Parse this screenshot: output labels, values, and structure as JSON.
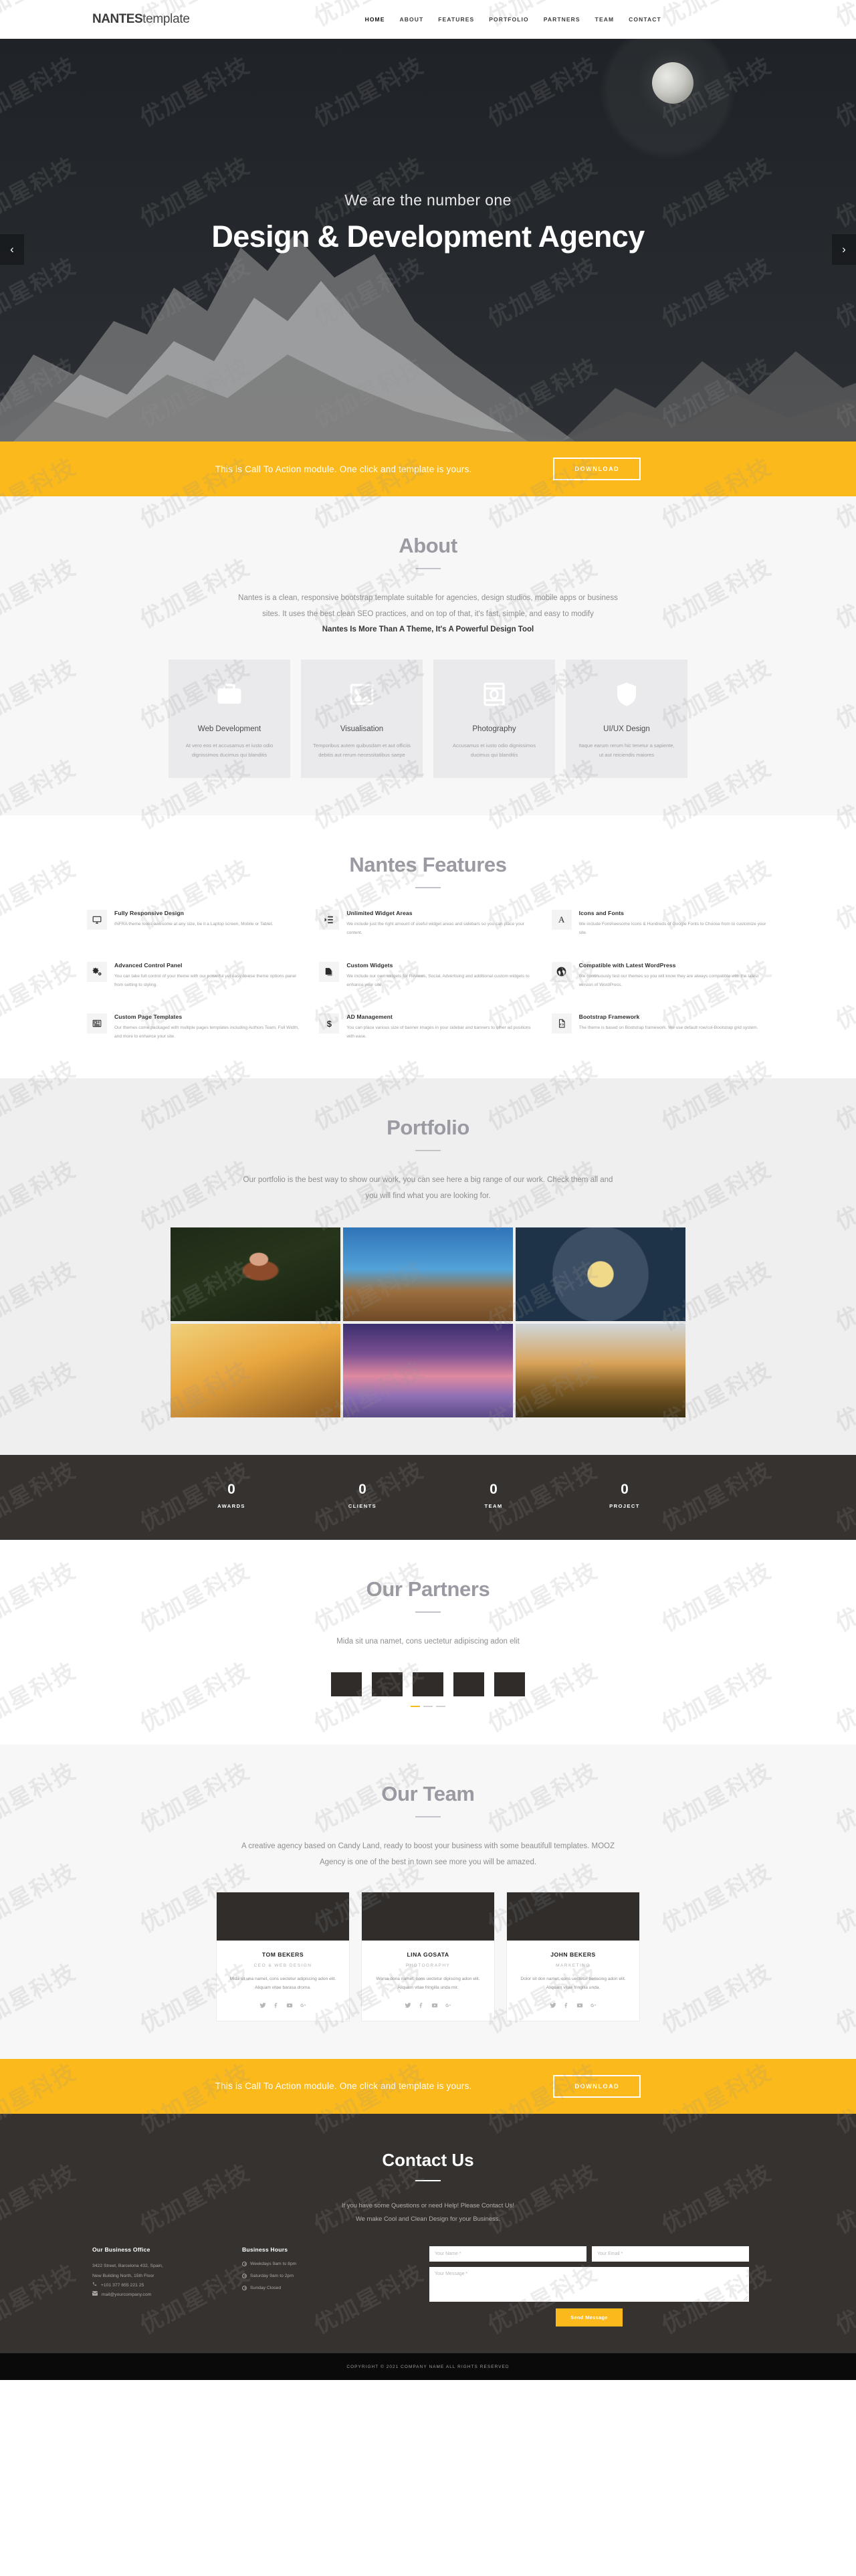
{
  "header": {
    "brand_bold": "NANTES",
    "brand_light": "template",
    "nav": [
      {
        "label": "HOME",
        "name": "nav-home"
      },
      {
        "label": "ABOUT",
        "name": "nav-about"
      },
      {
        "label": "FEATURES",
        "name": "nav-features"
      },
      {
        "label": "PORTFOLIO",
        "name": "nav-portfolio"
      },
      {
        "label": "PARTNERS",
        "name": "nav-partners"
      },
      {
        "label": "TEAM",
        "name": "nav-team"
      },
      {
        "label": "CONTACT",
        "name": "nav-contact"
      }
    ]
  },
  "hero": {
    "subtitle": "We are the number one",
    "title": "Design & Development Agency",
    "prev_icon": "‹",
    "next_icon": "›"
  },
  "cta": {
    "text": "This is Call To Action module. One click and template is yours.",
    "button": "DOWNLOAD",
    "accent": "#fbb91b"
  },
  "about": {
    "title": "About",
    "lead_line1": "Nantes is a clean, responsive bootstrap template suitable for agencies, design studios, mobile apps or business",
    "lead_line2": "sites. It uses the best clean SEO practices, and on top of that, it's fast, simple, and easy to modify",
    "lead_strong": "Nantes Is More Than A Theme, It's A Powerful Design Tool",
    "cards": [
      {
        "icon": "briefcase-icon",
        "title": "Web Development",
        "text": "At vero eos et accusamus et iusto odio dignissimos ducimus qui blanditis"
      },
      {
        "icon": "image-icon",
        "title": "Visualisation",
        "text": "Temporibus autem quibusdam et aut officiis debitis aut rerum necessitatibus saepe"
      },
      {
        "icon": "camera-icon",
        "title": "Photography",
        "text": "Accusamus et iusto odio dignissimos ducimus qui blanditis"
      },
      {
        "icon": "shield-icon",
        "title": "UI/UX Design",
        "text": "Itaque earum rerum hic tenetur a sapiente, ut aut reiciendis maiores"
      }
    ]
  },
  "features": {
    "title": "Nantes Features",
    "items": [
      {
        "icon": "monitor-icon",
        "glyph": "⎕",
        "title": "Fully Responsive Design",
        "text": "INFRA theme looks awesome at any size, be it a Laptop screen, Mobile or Tablet."
      },
      {
        "icon": "widget-list-icon",
        "glyph": "≡",
        "title": "Unlimited Widget Areas",
        "text": "We include just the right amount of useful widget areas and sidebars so you can place your content."
      },
      {
        "icon": "font-icon",
        "glyph": "A",
        "title": "Icons and Fonts",
        "text": "We include FontAwesome Icons & Hundreds of Google Fonts to Choose from to customize your site."
      },
      {
        "icon": "gears-icon",
        "glyph": "⚙",
        "title": "Advanced Control Panel",
        "text": "You can take full control of your theme with our powerful yet easy-to-use theme options panel from setting to styling."
      },
      {
        "icon": "copy-icon",
        "glyph": "❐",
        "title": "Custom Widgets",
        "text": "We include our own widgets for Reviews, Social, Advertising and additional custom widgets to enhance your site."
      },
      {
        "icon": "wordpress-icon",
        "glyph": "Ⓦ",
        "title": "Compatible with Latest WordPress",
        "text": "We continuously test our themes so you will know they are always compatible with the latest version of WordPress."
      },
      {
        "icon": "newspaper-icon",
        "glyph": "▤",
        "title": "Custom Page Templates",
        "text": "Our themes come packaged with multiple pages templates including Authors Team, Full Width, and more to enhance your site."
      },
      {
        "icon": "dollar-icon",
        "glyph": "$",
        "title": "AD Management",
        "text": "You can place various size of banner images in your sidebar and banners to other ad positions with ease."
      },
      {
        "icon": "code-file-icon",
        "glyph": "‹›",
        "title": "Bootstrap Framework",
        "text": "The theme is based on Bootstrap framework. We use default row/col-Bootstrap grid system."
      }
    ]
  },
  "portfolio": {
    "title": "Portfolio",
    "lead_line1": "Our portfolio is the best way to show our work, you can see here a big range of our work. Check them all and",
    "lead_line2": "you will find what you are looking for.",
    "items": [
      {
        "name": "portfolio-item-woman-forest"
      },
      {
        "name": "portfolio-item-architecture"
      },
      {
        "name": "portfolio-item-dome-ceiling"
      },
      {
        "name": "portfolio-item-golden-field"
      },
      {
        "name": "portfolio-item-boat-sunset"
      },
      {
        "name": "portfolio-item-cheers-bottles"
      }
    ]
  },
  "counters": [
    {
      "value": "0",
      "label": "AWARDS"
    },
    {
      "value": "0",
      "label": "CLIENTS"
    },
    {
      "value": "0",
      "label": "TEAM"
    },
    {
      "value": "0",
      "label": "PROJECT"
    }
  ],
  "partners": {
    "title": "Our Partners",
    "lead": "Mida sit una namet, cons uectetur adipiscing adon elit",
    "logo_count": 5,
    "dot_count": 3,
    "active_dot": 0
  },
  "team": {
    "title": "Our Team",
    "lead_line1": "A creative agency based on Candy Land, ready to boost your business with some beautifull templates. MOOZ",
    "lead_line2": "Agency is one of the best in town see more you will be amazed.",
    "members": [
      {
        "name": "TOM BEKERS",
        "role": "CEO & WEB DESIGN",
        "bio": "Mida sit una namet, cons uectetur adipiscing adon elit. Aliquam vitae barasa droma."
      },
      {
        "name": "LINA GOSATA",
        "role": "PHOTOGRAPHY",
        "bio": "Worsa dona namet, cons uectetur dipiscing adon elit. Aliquam vitae fringilla unda mir."
      },
      {
        "name": "JOHN BEKERS",
        "role": "MARKETING",
        "bio": "Dolor sit don namet, cons uectetur beriscing adon elit. Aliquam vitae fringilla unda."
      }
    ],
    "social_icons": [
      "twitter-icon",
      "facebook-icon",
      "youtube-icon",
      "google-plus-icon"
    ],
    "social_glyphs": [
      "🐦",
      "f",
      "▶",
      "g⁺"
    ]
  },
  "cta2": {
    "text": "This is Call To Action module. One click and template is yours.",
    "button": "DOWNLOAD"
  },
  "contact": {
    "title": "Contact Us",
    "lead_line1": "If you have some Questions or need Help! Please Contact Us!",
    "lead_line2": "We make Cool and Clean Design for your Business.",
    "office_head": "Our Business Office",
    "address_line1": "3422 Street, Barcelona 432, Spain,",
    "address_line2": "New Building North, 15th Floor",
    "phone": "+101 377 655 221 25",
    "email": "mail@yourcompany.com",
    "phone_icon": "phone-icon",
    "email_icon": "envelope-icon",
    "hours_head": "Business Hours",
    "hours": [
      "Weekdays 9am to 8pm",
      "Saturday 9am to 2pm",
      "Sunday Closed"
    ],
    "form": {
      "name_placeholder": "Your Name *",
      "email_placeholder": "Your Email *",
      "message_placeholder": "Your Message *",
      "submit": "Send Message"
    }
  },
  "footer": {
    "copyright": "COPYRIGHT © 2021 COMPANY NAME ALL RIGHTS RESERVED"
  },
  "watermark": {
    "text": "优加星科技"
  }
}
